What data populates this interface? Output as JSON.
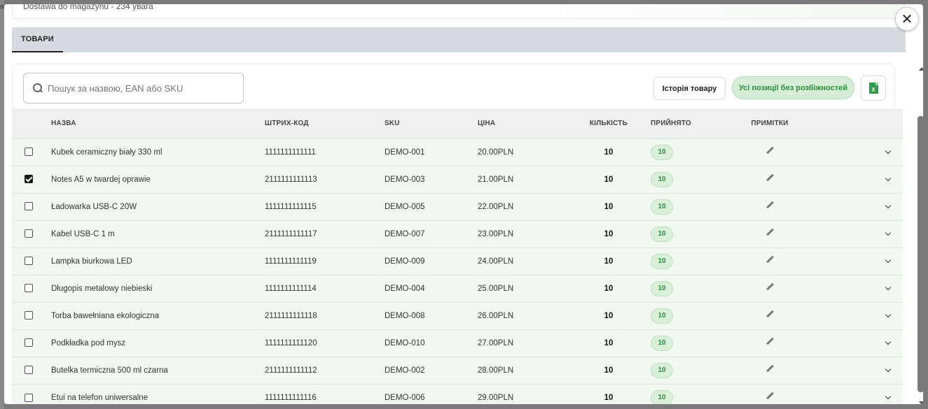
{
  "modal": {
    "header_text": "Dostawa do magazynu - 234 увага",
    "close_glyph": "✕"
  },
  "tabs": [
    {
      "label": "ТОВАРИ"
    }
  ],
  "toolbar": {
    "search_placeholder": "Пошук за назвою, EAN або SKU",
    "history_label": "Історія товару",
    "no_diff_label": "Усі позиції без розбіжностей",
    "excel_letter": "X"
  },
  "table": {
    "headers": {
      "name": "НАЗВА",
      "barcode": "ШТРИХ-КОД",
      "sku": "SKU",
      "price": "ЦІНА",
      "qty": "КІЛЬКІСТЬ",
      "accepted": "ПРИЙНЯТО",
      "notes": "ПРИМІТКИ"
    },
    "rows": [
      {
        "checked": false,
        "name": "Kubek ceramiczny biały 330 ml",
        "barcode": "1111111111111",
        "sku": "DEMO-001",
        "price": "20.00PLN",
        "qty": "10",
        "accepted": "10"
      },
      {
        "checked": true,
        "name": "Notes A5 w twardej oprawie",
        "barcode": "2111111111113",
        "sku": "DEMO-003",
        "price": "21.00PLN",
        "qty": "10",
        "accepted": "10"
      },
      {
        "checked": false,
        "name": "Ładowarka USB-C 20W",
        "barcode": "1111111111115",
        "sku": "DEMO-005",
        "price": "22.00PLN",
        "qty": "10",
        "accepted": "10"
      },
      {
        "checked": false,
        "name": "Kabel USB-C 1 m",
        "barcode": "2111111111117",
        "sku": "DEMO-007",
        "price": "23.00PLN",
        "qty": "10",
        "accepted": "10"
      },
      {
        "checked": false,
        "name": "Lampka biurkowa LED",
        "barcode": "1111111111119",
        "sku": "DEMO-009",
        "price": "24.00PLN",
        "qty": "10",
        "accepted": "10"
      },
      {
        "checked": false,
        "name": "Długopis metalowy niebieski",
        "barcode": "1111111111114",
        "sku": "DEMO-004",
        "price": "25.00PLN",
        "qty": "10",
        "accepted": "10"
      },
      {
        "checked": false,
        "name": "Torba bawełniana ekologiczna",
        "barcode": "2111111111118",
        "sku": "DEMO-008",
        "price": "26.00PLN",
        "qty": "10",
        "accepted": "10"
      },
      {
        "checked": false,
        "name": "Podkładka pod mysz",
        "barcode": "1111111111120",
        "sku": "DEMO-010",
        "price": "27.00PLN",
        "qty": "10",
        "accepted": "10"
      },
      {
        "checked": false,
        "name": "Butelka termiczna 500 ml czarna",
        "barcode": "2111111111112",
        "sku": "DEMO-002",
        "price": "28.00PLN",
        "qty": "10",
        "accepted": "10"
      },
      {
        "checked": false,
        "name": "Etui na telefon uniwersalne",
        "barcode": "1111111111116",
        "sku": "DEMO-006",
        "price": "29.00PLN",
        "qty": "10",
        "accepted": "10"
      }
    ]
  },
  "colors": {
    "accent_green": "#2e8b3e",
    "row_background": "#f1f8ef",
    "tab_bar": "#d5dbe1"
  }
}
